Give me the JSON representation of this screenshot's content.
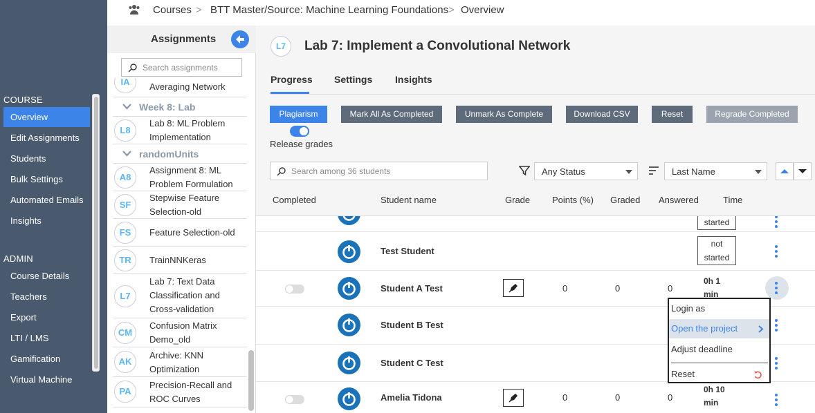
{
  "nav": {
    "course_label": "COURSE",
    "course_items": [
      "Overview",
      "Edit Assignments",
      "Students",
      "Bulk Settings",
      "Automated Emails",
      "Insights"
    ],
    "admin_label": "ADMIN",
    "admin_items": [
      "Course Details",
      "Teachers",
      "Export",
      "LTI / LMS",
      "Gamification",
      "Virtual Machine"
    ],
    "active_item": "Overview"
  },
  "breadcrumb": {
    "items": [
      "Courses",
      "BTT Master/Source: Machine Learning Foundations",
      "Overview"
    ],
    "separator": ">"
  },
  "assignments": {
    "title": "Assignments",
    "search_placeholder": "Search assignments",
    "items": [
      {
        "code": "IA",
        "label": "Averaging Network"
      },
      {
        "week": "Week 8: Lab"
      },
      {
        "code": "L8",
        "label": "Lab 8: ML Problem Implementation"
      },
      {
        "week": "randomUnits"
      },
      {
        "code": "A8",
        "label": "Assignment 8: ML Problem Formulation"
      },
      {
        "code": "SF",
        "label": "Stepwise Feature Selection-old"
      },
      {
        "code": "FS",
        "label": "Feature Selection-old"
      },
      {
        "code": "TR",
        "label": "TrainNNKeras"
      },
      {
        "code": "L7",
        "label": "Lab 7: Text Data Classification and Cross-validation"
      },
      {
        "code": "CM",
        "label": "Confusion Matrix Demo_old"
      },
      {
        "code": "AK",
        "label": "Archive: KNN Optimization"
      },
      {
        "code": "PA",
        "label": "Precision-Recall and ROC Curves"
      }
    ]
  },
  "lab": {
    "code": "L7",
    "title": "Lab 7: Implement a Convolutional Network"
  },
  "tabs": [
    "Progress",
    "Settings",
    "Insights"
  ],
  "toolbar": {
    "buttons": [
      "Plagiarism",
      "Mark All As Completed",
      "Unmark As Complete",
      "Download CSV",
      "Reset",
      "Regrade Completed"
    ],
    "release_label": "Release grades"
  },
  "filters": {
    "search_placeholder": "Search among 36 students",
    "status_value": "Any Status",
    "sort_value": "Last Name"
  },
  "table": {
    "headers": [
      "Completed",
      "Student name",
      "Grade",
      "Points (%)",
      "Graded",
      "Answered",
      "Time"
    ],
    "rows": [
      {
        "name": "",
        "status": "started"
      },
      {
        "name": "Test Student",
        "status": "not started"
      },
      {
        "name": "Student A Test",
        "points": "0",
        "graded": "0",
        "answered": "0",
        "time": "0h 1 min"
      },
      {
        "name": "Student B Test"
      },
      {
        "name": "Student C Test"
      },
      {
        "name": "Amelia Tidona",
        "points": "0",
        "graded": "0",
        "answered": "0",
        "time": "0h 10 min"
      }
    ]
  },
  "context_menu": {
    "items": [
      "Login as",
      "Open the project",
      "Adjust deadline",
      "Reset"
    ],
    "highlighted": "Open the project"
  },
  "colors": {
    "accent": "#3d84e8",
    "nav_bg": "#4a5a6e",
    "button_gray": "#5e6b7b",
    "code_blue": "#5bb6f0"
  }
}
